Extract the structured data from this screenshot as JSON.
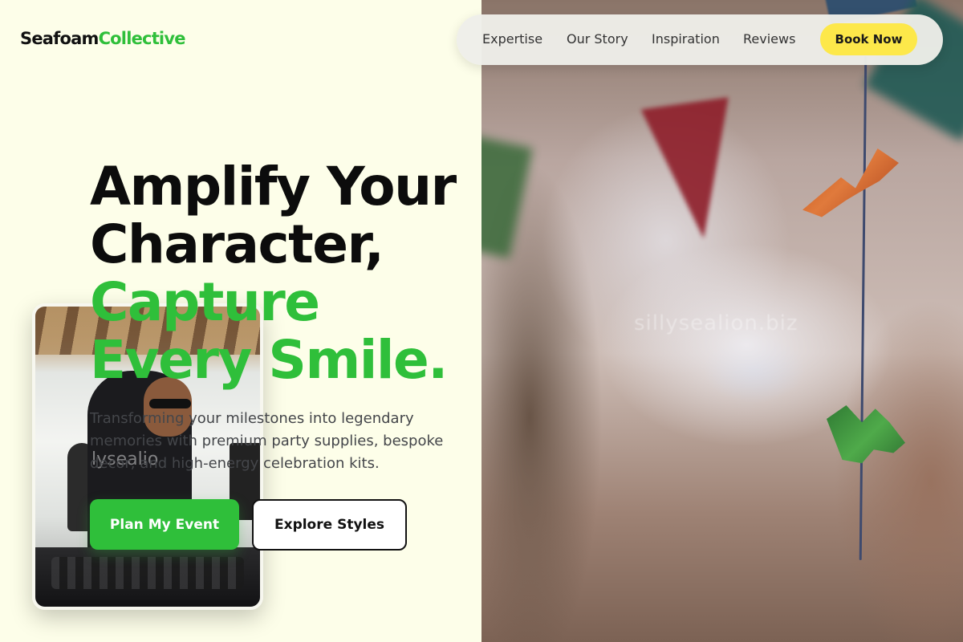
{
  "brand": {
    "name_part1": "Seafoam",
    "name_part2": "Collective",
    "accent_color": "#2fbf3a"
  },
  "nav": {
    "links": [
      "Expertise",
      "Our Story",
      "Inspiration",
      "Reviews"
    ],
    "cta_label": "Book Now",
    "cta_color": "#fde84a"
  },
  "hero": {
    "headline_line1": "Amplify Your",
    "headline_line2": "Character,",
    "headline_line3": "Capture",
    "headline_line4": "Every Smile.",
    "subcopy": "Transforming your milestones into legendary memories with premium party supplies, bespoke decor, and high-energy celebration kits.",
    "primary_button": "Plan My Event",
    "secondary_button": "Explore Styles"
  },
  "media": {
    "card_image": "dj-at-turntables-photo",
    "card_watermark": "lysealio",
    "background_image": "party-bunting-photo",
    "background_watermark": "sillysealion.biz"
  }
}
